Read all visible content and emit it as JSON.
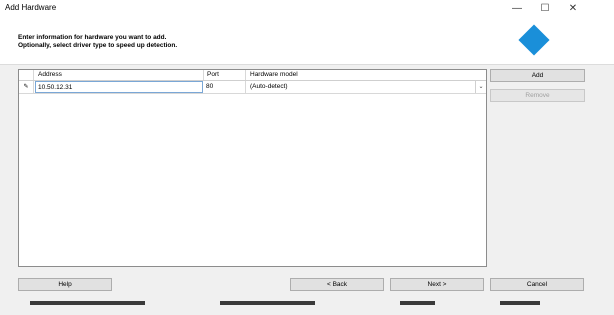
{
  "window": {
    "title": "Add Hardware",
    "minimize_glyph": "—",
    "maximize_glyph": "☐",
    "close_glyph": "✕"
  },
  "header": {
    "line1": "Enter information for hardware you want to add.",
    "line2": "Optionally, select driver type to speed up detection.",
    "icon": "blue-diamond-icon",
    "icon_color": "#1a8fd9"
  },
  "grid": {
    "columns": [
      "Address",
      "Port",
      "Hardware model"
    ],
    "rows": [
      {
        "marker": "✎",
        "address": "10.50.12.31",
        "port": "80",
        "model": "(Auto-detect)"
      }
    ],
    "dropdown_glyph": "⌄"
  },
  "side_buttons": {
    "add": "Add",
    "remove": "Remove"
  },
  "footer": {
    "help": "Help",
    "back": "< Back",
    "next": "Next >",
    "cancel": "Cancel"
  }
}
